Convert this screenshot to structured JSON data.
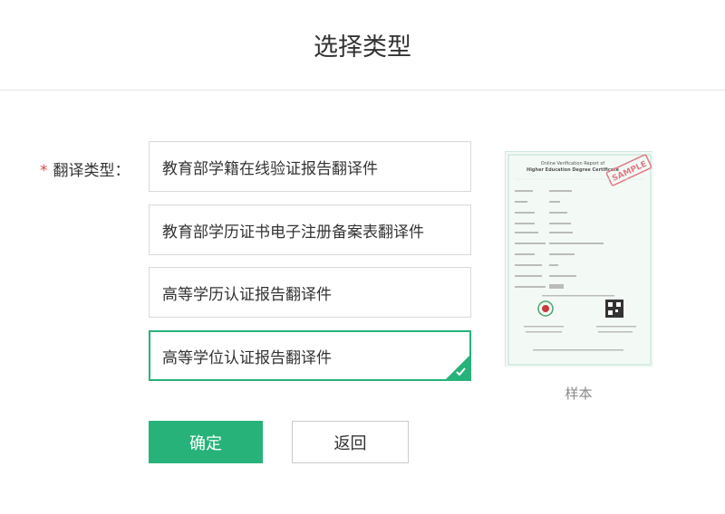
{
  "dialog": {
    "title": "选择类型"
  },
  "form": {
    "required_mark": "*",
    "label": "翻译类型："
  },
  "options": [
    {
      "label": "教育部学籍在线验证报告翻译件",
      "selected": false
    },
    {
      "label": "教育部学历证书电子注册备案表翻译件",
      "selected": false
    },
    {
      "label": "高等学历认证报告翻译件",
      "selected": false
    },
    {
      "label": "高等学位认证报告翻译件",
      "selected": true
    }
  ],
  "sample": {
    "caption": "样本",
    "stamp": "SAMPLE",
    "heading_line1": "Online Verification Report of",
    "heading_line2": "Higher Education Degree Certificate"
  },
  "buttons": {
    "confirm": "确定",
    "back": "返回"
  },
  "colors": {
    "accent": "#27b27a",
    "required": "#e64340"
  }
}
